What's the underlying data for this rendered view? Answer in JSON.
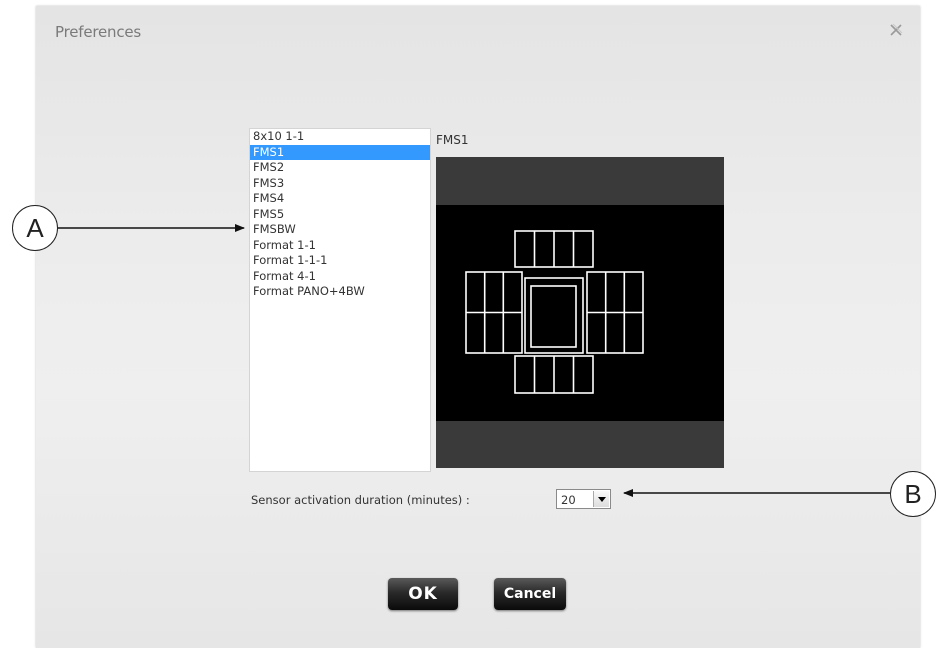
{
  "dialog": {
    "title": "Preferences"
  },
  "layout_list": {
    "items": [
      "8x10 1-1",
      "FMS1",
      "FMS2",
      "FMS3",
      "FMS4",
      "FMS5",
      "FMSBW",
      "Format 1-1",
      "Format 1-1-1",
      "Format 4-1",
      "Format PANO+4BW"
    ],
    "selected": "FMS1"
  },
  "preview": {
    "label": "FMS1"
  },
  "sensor": {
    "label": "Sensor activation duration (minutes) :",
    "value": "20"
  },
  "buttons": {
    "ok": "OK",
    "cancel": "Cancel"
  },
  "callouts": {
    "a": "A",
    "b": "B"
  },
  "colors": {
    "selection": "#3399ff",
    "preview_bg": "#000000",
    "preview_band": "#3a3a3a"
  },
  "icons": {
    "close": "close-icon",
    "dropdown": "chevron-down-icon"
  }
}
